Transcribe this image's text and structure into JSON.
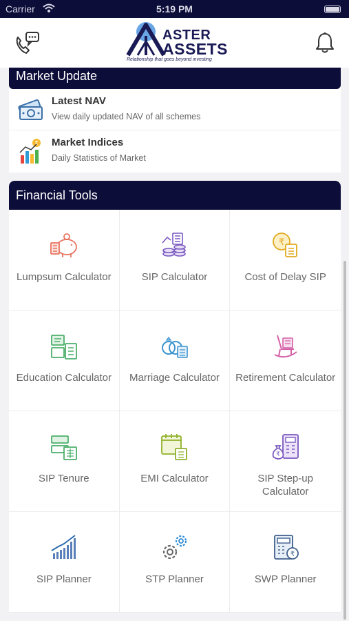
{
  "status_bar": {
    "carrier": "Carrier",
    "time": "5:19 PM"
  },
  "brand": {
    "line1": "ASTER",
    "line2": "ASSETS",
    "tagline": "Relationship that goes beyond investing"
  },
  "icons": {
    "call": "phone-chat-icon",
    "bell": "bell-icon"
  },
  "market_update": {
    "title": "Market Update",
    "items": [
      {
        "title": "Latest NAV",
        "subtitle": "View daily updated NAV of all schemes",
        "icon": "money-icon"
      },
      {
        "title": "Market Indices",
        "subtitle": "Daily Statistics of Market",
        "icon": "bar-chart-rupee-icon"
      }
    ]
  },
  "financial_tools": {
    "title": "Financial Tools",
    "tools": [
      {
        "label": "Lumpsum Calculator",
        "icon": "piggy-bank-icon"
      },
      {
        "label": "SIP Calculator",
        "icon": "coins-icon"
      },
      {
        "label": "Cost of Delay SIP",
        "icon": "rupee-clock-icon"
      },
      {
        "label": "Education Calculator",
        "icon": "education-calculator-icon"
      },
      {
        "label": "Marriage Calculator",
        "icon": "rings-icon"
      },
      {
        "label": "Retirement Calculator",
        "icon": "rocking-chair-icon"
      },
      {
        "label": "SIP Tenure",
        "icon": "tenure-calculator-icon"
      },
      {
        "label": "EMI Calculator",
        "icon": "calendar-calculator-icon"
      },
      {
        "label": "SIP Step-up Calculator",
        "icon": "money-bag-calculator-icon"
      },
      {
        "label": "SIP Planner",
        "icon": "growth-chart-icon"
      },
      {
        "label": "STP Planner",
        "icon": "gears-icon"
      },
      {
        "label": "SWP Planner",
        "icon": "calculator-rupee-icon"
      }
    ]
  },
  "colors": {
    "header_dark": "#0d0d3a",
    "brand_blue": "#1a1a55"
  }
}
